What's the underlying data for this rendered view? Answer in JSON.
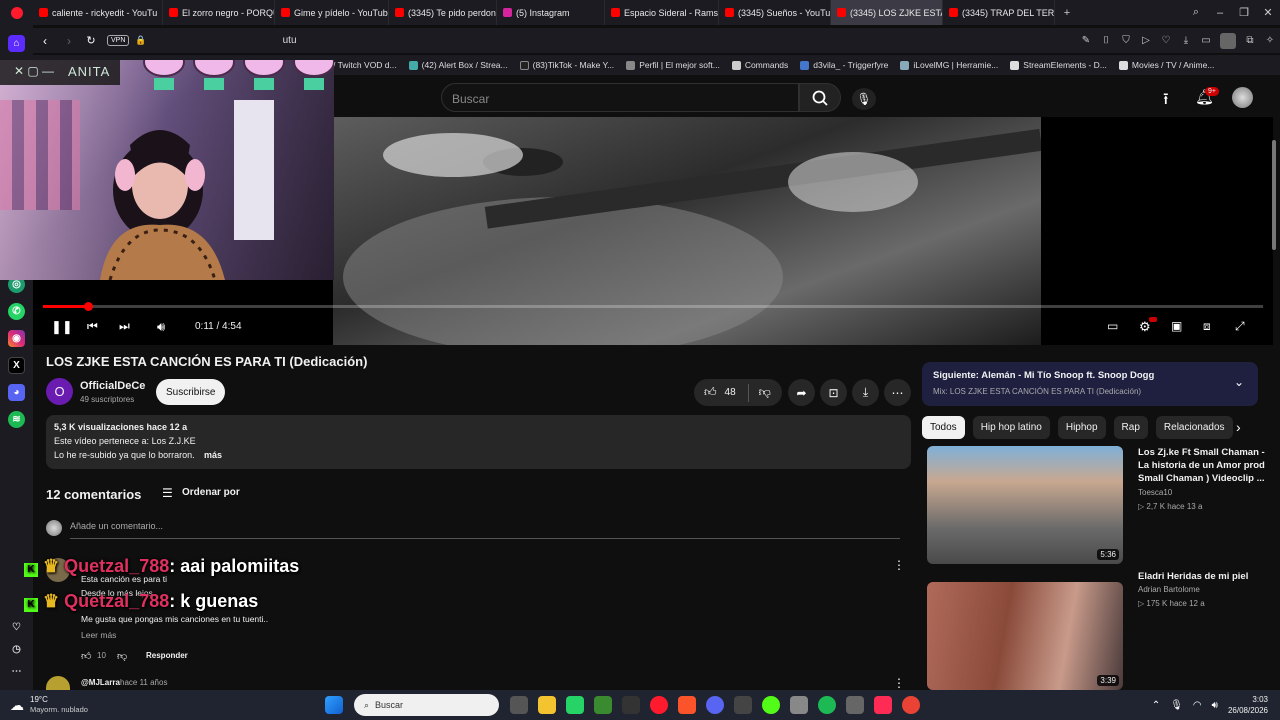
{
  "browser": {
    "tabs": [
      {
        "label": "caliente - rickyedit - YouTu",
        "color": "#ff0000"
      },
      {
        "label": "El zorro negro - PORQUE",
        "color": "#ff0000"
      },
      {
        "label": "Gime y pídelo - YouTube",
        "color": "#ff0000"
      },
      {
        "label": "(3345) Te pido perdon pa",
        "color": "#ff0000"
      },
      {
        "label": "(5) Instagram",
        "color": "#d6249f"
      },
      {
        "label": "Espacio Sideral - Ramses I",
        "color": "#ff0000"
      },
      {
        "label": "(3345) Sueños - YouTube",
        "color": "#ff0000"
      },
      {
        "label": "(3345) LOS ZJKE ESTA",
        "color": "#ff0000"
      },
      {
        "label": "(3345) TRAP DEL TERRAPL",
        "color": "#ff0000"
      }
    ],
    "new_tab": "+",
    "address_partial": "utu",
    "vpn_label": "VPN",
    "bookmarks": [
      "/ Twitch VOD d...",
      "(42) Alert Box / Strea...",
      "(83)TikTok - Make Y...",
      "Perfil | El mejor soft...",
      "Commands",
      "d3vila_ - Triggerfyre",
      "iLovelMG | Herramie...",
      "StreamElements - D...",
      "Movies / TV / Anime..."
    ]
  },
  "overlay": {
    "streamer_name": "ANITA",
    "chat": [
      {
        "user": "Quetzal_788",
        "message": ": aai palomiitas"
      },
      {
        "user": "Quetzal_788",
        "message": ": k guenas"
      }
    ]
  },
  "youtube": {
    "search_placeholder": "Buscar",
    "notif_count": "9+",
    "player": {
      "time": "0:11 / 4:54",
      "progress_fraction": 0.037
    },
    "video_title": "LOS ZJKE ESTA CANCIÓN ES PARA TI (Dedicación)",
    "channel": {
      "initial": "O",
      "name": "OfficialDeCe",
      "subs": "49 suscriptores"
    },
    "subscribe_label": "Suscribirse",
    "likes": "48",
    "description": {
      "stats": "5,3 K visualizaciones  hace 12 a",
      "line1": "Este vídeo pertenece a: Los Z.J.KE",
      "line2": "Lo he re-subido ya que lo borraron.",
      "more": "más"
    },
    "comments": {
      "count_label": "12 comentarios",
      "sort_label": "Ordenar por",
      "add_placeholder": "Añade un comentario...",
      "first": {
        "line1": "Esta canción es para ti",
        "line2": "Desde lo más lejos",
        "line4": "Me gusta que pongas mis canciones en tu tuenti..",
        "read_more": "Leer más",
        "likes": "10",
        "reply": "Responder"
      },
      "second": {
        "author": "@MJLarra",
        "time": "hace 11 años"
      }
    },
    "up_next": {
      "title": "Siguiente: Alemán - Mi Tío Snoop ft. Snoop Dogg",
      "mix": "Mix: LOS ZJKE ESTA CANCIÓN ES PARA TI (Dedicación)"
    },
    "chips": [
      "Todos",
      "Hip hop latino",
      "Hiphop",
      "Rap",
      "Relacionados"
    ],
    "recommendations": [
      {
        "title": "Los Zj.ke Ft Small Chaman - La historia de un Amor  prod Small Chaman ) Videoclip ...",
        "channel": "Toesca10",
        "meta": "▷ 2,7 K  hace 13 a",
        "duration": "5:36"
      },
      {
        "title": "Eladri Heridas de mi piel",
        "channel": "Adrian Bartolome",
        "meta": "▷ 175 K  hace 12 a",
        "duration": "3:39"
      }
    ]
  },
  "taskbar": {
    "weather_temp": "19°C",
    "weather_desc": "Mayorm. nublado",
    "search_label": "Buscar",
    "time": "3:03",
    "date": "26/08/2026"
  }
}
